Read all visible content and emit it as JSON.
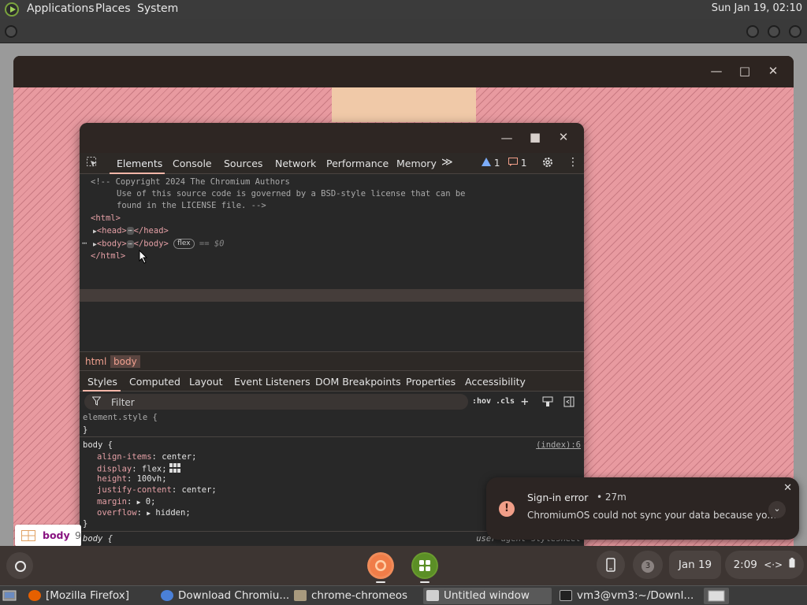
{
  "gnome_panel": {
    "menus": [
      "Applications",
      "Places",
      "System"
    ],
    "clock": "Sun Jan 19, 02:10"
  },
  "devtools": {
    "tabs": [
      "Elements",
      "Console",
      "Sources",
      "Network",
      "Performance",
      "Memory"
    ],
    "more_tabs": "≫",
    "warnings": "1",
    "issues": "1",
    "source": {
      "comment1": "<!-- Copyright 2024 The Chromium Authors",
      "comment2": "Use of this source code is governed by a BSD-style license that can be",
      "comment3": "found in the LICENSE file. -->",
      "html_open": "<html>",
      "head_open": "<head>",
      "head_close": "</head>",
      "body_open": "<body>",
      "body_close": "</body>",
      "flex_pill": "flex",
      "selected_ref": "== $0",
      "html_close": "</html>"
    },
    "breadcrumbs": [
      "html",
      "body"
    ],
    "style_tabs": [
      "Styles",
      "Computed",
      "Layout",
      "Event Listeners",
      "DOM Breakpoints",
      "Properties",
      "Accessibility"
    ],
    "filter_placeholder": "Filter",
    "hov": ":hov",
    "cls": ".cls",
    "styles": {
      "element_style": "element.style {",
      "close_brace": "}",
      "body_selector": "body {",
      "source_link": "(index):6",
      "props": [
        {
          "name": "align-items",
          "value": "center;"
        },
        {
          "name": "display",
          "value": "flex;"
        },
        {
          "name": "height",
          "value": "100vh;"
        },
        {
          "name": "justify-content",
          "value": "center;"
        },
        {
          "name": "margin",
          "value": "0;"
        },
        {
          "name": "overflow",
          "value": "hidden;"
        }
      ],
      "ua_selector": "body {",
      "ua_label": "user agent stylesheet"
    }
  },
  "notification": {
    "title": "Sign-in error",
    "time": "• 27m",
    "body": "ChromiumOS could not sync your data because yo…",
    "icon": "!"
  },
  "body_chip": {
    "label": "body",
    "suffix": "9"
  },
  "shelf": {
    "badge": "3",
    "date": "Jan 19",
    "time": "2:09"
  },
  "taskbar": [
    {
      "label": "[Mozilla Firefox]",
      "icon": "firefox-icon"
    },
    {
      "label": "Download Chromiu...",
      "icon": "chrome-icon"
    },
    {
      "label": "chrome-chromeos",
      "icon": "folder-icon"
    },
    {
      "label": "Untitled window",
      "icon": "window-icon"
    },
    {
      "label": "vm3@vm3:~/Downl...",
      "icon": "terminal-icon"
    }
  ],
  "colors": {
    "accent": "#f4b6a8",
    "tag": "#e5a0a6",
    "page_pink": "#e89aa0"
  }
}
